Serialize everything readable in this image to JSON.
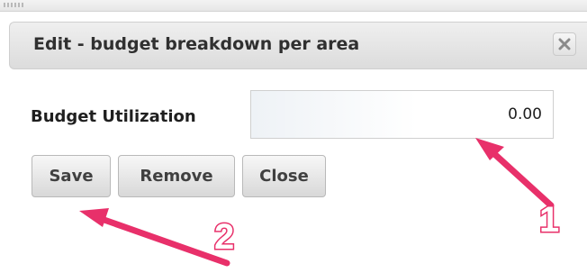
{
  "dialog": {
    "title": "Edit - budget breakdown per area",
    "close_icon": "close-x-icon"
  },
  "form": {
    "label": "Budget Utilization",
    "value": "0.00"
  },
  "buttons": {
    "save": "Save",
    "remove": "Remove",
    "close": "Close"
  },
  "annotations": {
    "marker_1": "1",
    "marker_2": "2",
    "arrow_color": "#e8306a"
  }
}
